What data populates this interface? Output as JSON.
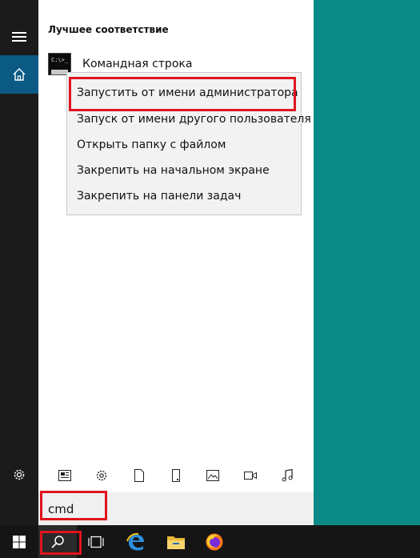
{
  "start_menu": {
    "best_match_heading": "Лучшее соответствие",
    "best_match_app": "Командная строка",
    "app_icon_prompt": "C:\\>_",
    "context_menu": [
      "Запустить от имени администратора",
      "Запуск от имени другого пользователя",
      "Открыть папку с файлом",
      "Закрепить на начальном экране",
      "Закрепить на панели задач"
    ],
    "search_query": "cmd"
  },
  "filter_icons": [
    "news-icon",
    "settings-icon",
    "document-icon",
    "device-icon",
    "photo-icon",
    "video-icon",
    "music-icon"
  ],
  "taskbar": [
    "windows-start-icon",
    "search-icon",
    "task-view-icon",
    "edge-icon",
    "file-explorer-icon",
    "firefox-icon"
  ],
  "colors": {
    "desktop": "#0a8a86",
    "rail": "#1b1b1b",
    "home_active": "#0a5a84",
    "highlight_box": "#e0141e",
    "taskbar": "#151515"
  }
}
